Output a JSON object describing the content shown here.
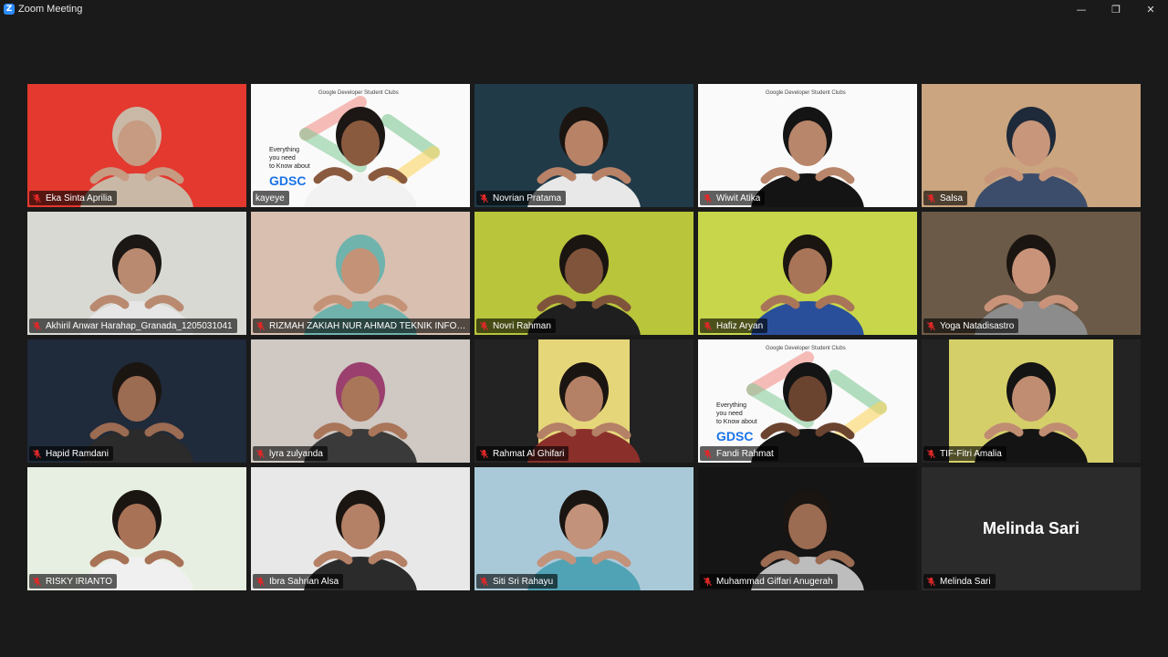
{
  "window": {
    "app_icon_letter": "Z",
    "title": "Zoom Meeting",
    "controls": [
      "—",
      "❐",
      "✕"
    ]
  },
  "slide": {
    "header": "Google Developer Student Clubs",
    "line1": "Everything",
    "line2": "you need",
    "line3": "to Know about",
    "brand": "GDSC"
  },
  "placeholder_name_display": "Melinda Sari",
  "participants": [
    {
      "name": "Eka Sinta Aprilia",
      "muted": true,
      "bg": "#e3392f",
      "skin": "#c79a82",
      "hair": "#c9b8a6",
      "shirt": "#c9b8a6"
    },
    {
      "name": "kayeye",
      "muted": false,
      "bg": "slide",
      "skin": "#8a5a3f",
      "hair": "#1c1714",
      "shirt": "#f2f2f2",
      "active": true
    },
    {
      "name": "Novrian Pratama",
      "muted": true,
      "bg": "#203a48",
      "skin": "#b88267",
      "hair": "#1b1511",
      "shirt": "#e8e8e8"
    },
    {
      "name": "Wiwit Atika",
      "muted": true,
      "bg": "slide-white",
      "skin": "#b8866a",
      "hair": "#141414",
      "shirt": "#141414"
    },
    {
      "name": "Salsa",
      "muted": true,
      "bg": "#caa57f",
      "skin": "#c8967a",
      "hair": "#1e2a3a",
      "shirt": "#3c4d6b"
    },
    {
      "name": "Akhiril Anwar Harahap_Granada_1205031041",
      "muted": true,
      "bg": "#d9d9d4",
      "skin": "#b98a70",
      "hair": "#1b1714",
      "shirt": "#e6e6e6"
    },
    {
      "name": "RIZMAH ZAKIAH NUR AHMAD TEKNIK INFORMATIKA",
      "muted": true,
      "bg": "#d8bfb0",
      "skin": "#c49276",
      "hair": "#6fb3ac",
      "shirt": "#6fb3ac"
    },
    {
      "name": "Novri Rahman",
      "muted": true,
      "bg": "#b9c53a",
      "skin": "#7f543b",
      "hair": "#1b1511",
      "shirt": "#1f1f1f"
    },
    {
      "name": "Hafiz Aryan",
      "muted": true,
      "bg": "#c7d64a",
      "skin": "#a97559",
      "hair": "#1b1511",
      "shirt": "#2a4f9a"
    },
    {
      "name": "Yoga Natadisastro",
      "muted": true,
      "bg": "#6b5a47",
      "skin": "#c9937a",
      "hair": "#1b1511",
      "shirt": "#8c8c8c"
    },
    {
      "name": "Hapid Ramdani",
      "muted": true,
      "bg": "#1f2a3a",
      "skin": "#9b6b52",
      "hair": "#1b1511",
      "shirt": "#2b2b2b"
    },
    {
      "name": "lyra zulyanda",
      "muted": true,
      "bg": "#cfc8c3",
      "skin": "#a9765a",
      "hair": "#9b3f6f",
      "shirt": "#3a3a3a"
    },
    {
      "name": "Rahmat Al Ghifari",
      "muted": true,
      "bg": "#e6d67a",
      "skin": "#b48066",
      "hair": "#1b1511",
      "shirt": "#8a2f2a",
      "narrow": true
    },
    {
      "name": "Fandi Rahmat",
      "muted": true,
      "bg": "slide",
      "skin": "#6b4430",
      "hair": "#141414",
      "shirt": "#141414"
    },
    {
      "name": "TIF-Fitri Amalia",
      "muted": true,
      "bg": "#d5cf6a",
      "skin": "#c08d72",
      "hair": "#141414",
      "shirt": "#141414",
      "narrow": true
    },
    {
      "name": "RISKY IRIANTO",
      "muted": true,
      "bg": "#e7efe2",
      "skin": "#a87257",
      "hair": "#1b1511",
      "shirt": "#f0f0f0"
    },
    {
      "name": "Ibra Sahrian Alsa",
      "muted": true,
      "bg": "#e8e8e8",
      "skin": "#b48066",
      "hair": "#1b1511",
      "shirt": "#2b2b2b"
    },
    {
      "name": "Siti Sri Rahayu",
      "muted": true,
      "bg": "#a9c9d9",
      "skin": "#c2927a",
      "hair": "#1b1511",
      "shirt": "#4fa3b5"
    },
    {
      "name": "Muhammad Giffari Anugerah",
      "muted": true,
      "bg": "#151515",
      "skin": "#9b6b52",
      "hair": "#1b1511",
      "shirt": "#bdbdbd"
    },
    {
      "name": "Melinda Sari",
      "muted": true,
      "bg": "none"
    }
  ]
}
